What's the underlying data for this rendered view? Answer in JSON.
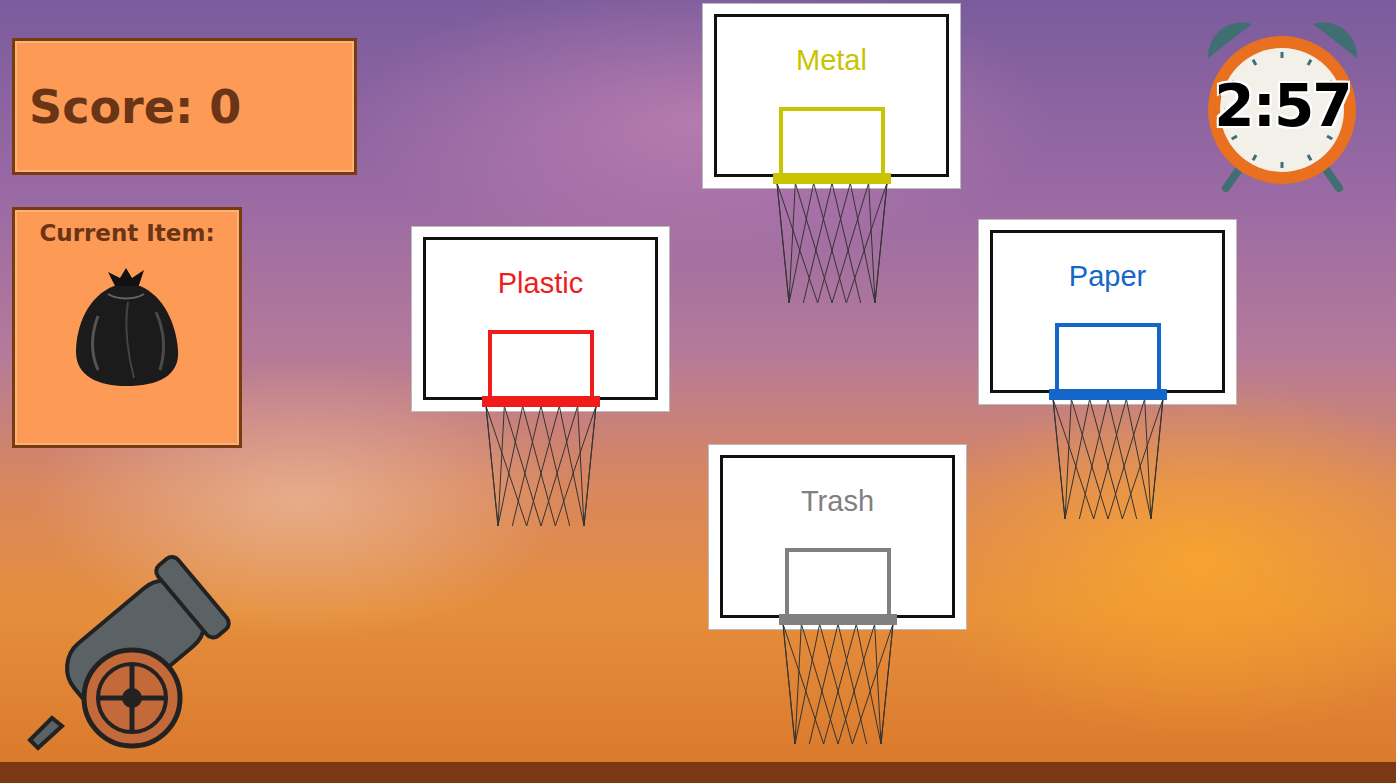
{
  "score": {
    "label": "Score: 0"
  },
  "current_item": {
    "label": "Current Item:"
  },
  "timer": {
    "time": "2:57"
  },
  "hoops": [
    {
      "label": "Metal",
      "color": "#c8c400"
    },
    {
      "label": "Plastic",
      "color": "#f01c1c"
    },
    {
      "label": "Paper",
      "color": "#1467c8"
    },
    {
      "label": "Trash",
      "color": "#808080"
    }
  ]
}
